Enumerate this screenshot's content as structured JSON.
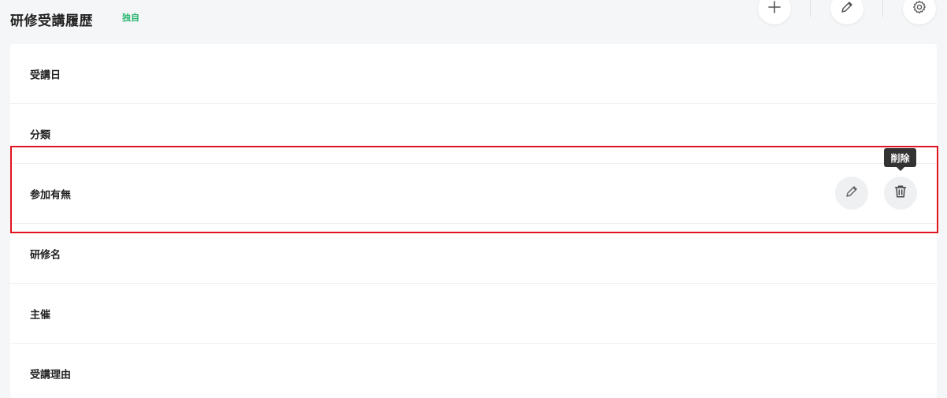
{
  "header": {
    "title": "研修受講履歴",
    "badge": "独自",
    "badge_color": "#2bb673",
    "actions": [
      {
        "icon": "plus-icon"
      },
      {
        "icon": "pencil-icon"
      },
      {
        "icon": "gear-icon"
      }
    ]
  },
  "fields": [
    {
      "label": "受講日"
    },
    {
      "label": "分類"
    },
    {
      "label": "参加有無"
    },
    {
      "label": "研修名"
    },
    {
      "label": "主催"
    },
    {
      "label": "受講理由"
    }
  ],
  "row_actions": {
    "edit_icon": "pencil-icon",
    "delete_icon": "trash-icon",
    "delete_tooltip": "削除"
  },
  "highlight_color": "#e0141e"
}
